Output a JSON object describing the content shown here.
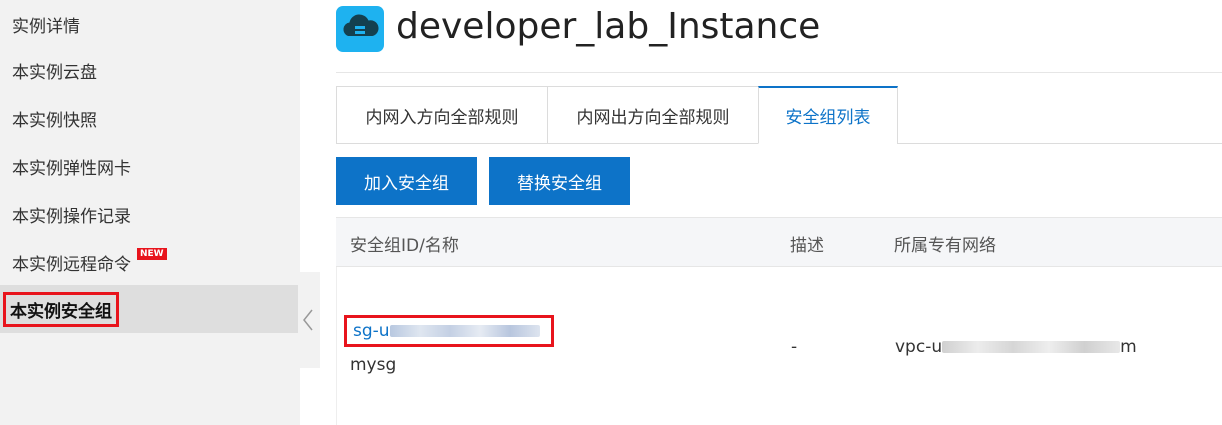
{
  "sidebar": {
    "items": [
      {
        "label": "实例详情"
      },
      {
        "label": "本实例云盘"
      },
      {
        "label": "本实例快照"
      },
      {
        "label": "本实例弹性网卡"
      },
      {
        "label": "本实例操作记录"
      },
      {
        "label": "本实例远程命令",
        "badge": "NEW"
      },
      {
        "label": "本实例安全组",
        "active": true
      }
    ]
  },
  "header": {
    "title": "developer_lab_Instance",
    "icon": "cloud-server-icon"
  },
  "tabs": [
    {
      "label": "内网入方向全部规则"
    },
    {
      "label": "内网出方向全部规则"
    },
    {
      "label": "安全组列表",
      "active": true
    }
  ],
  "actions": {
    "join_label": "加入安全组",
    "replace_label": "替换安全组"
  },
  "table": {
    "columns": [
      "安全组ID/名称",
      "描述",
      "所属专有网络"
    ],
    "rows": [
      {
        "id_prefix": "sg-u",
        "id_suffix": "",
        "name": "mysg",
        "description": "-",
        "vpc_prefix": "vpc-u",
        "vpc_suffix": "m"
      }
    ]
  },
  "colors": {
    "accent": "#0d73c8",
    "highlight": "#e8141c",
    "icon": "#1eb2f0"
  }
}
